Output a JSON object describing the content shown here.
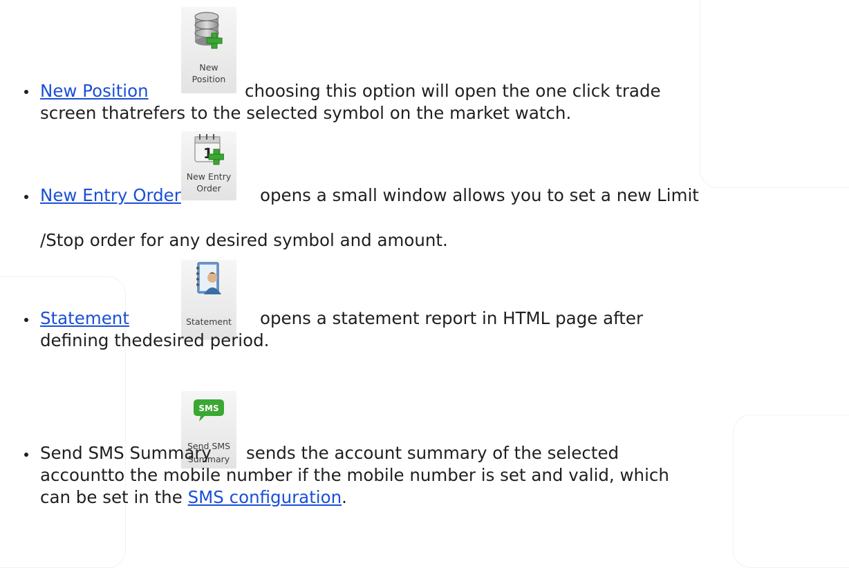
{
  "items": [
    {
      "link": "New Position",
      "icon": "database-add-icon",
      "icon_label_1": "New",
      "icon_label_2": "Position",
      "line1": "choosing this option will open the one click trade",
      "line2": "screen thatrefers to the selected symbol on the market watch."
    },
    {
      "link": "New Entry Order",
      "icon": "calendar-add-icon",
      "icon_label_1": "New Entry",
      "icon_label_2": "Order",
      "line1": "opens a small window allows you to set a new Limit",
      "line2": "/Stop order for any desired symbol and amount."
    },
    {
      "link": "Statement",
      "icon": "address-book-icon",
      "icon_label_1": "Statement",
      "line1": "opens a statement report in HTML page after",
      "line2": "defining thedesired period."
    },
    {
      "title": "Send SMS Summary",
      "icon": "sms-bubble-icon",
      "icon_badge": "SMS",
      "icon_label_1": "Send SMS",
      "icon_label_2": "Summary",
      "line1": "sends the account summary of the selected",
      "line2": "accountto the mobile number if the mobile number is set and valid, which",
      "line3_prefix": "can be set in the",
      "line3_link": "SMS configuration",
      "line3_suffix": "."
    }
  ],
  "colors": {
    "link": "#1a4fd6",
    "text": "#1f1f1f",
    "icon_green": "#3aa832"
  }
}
